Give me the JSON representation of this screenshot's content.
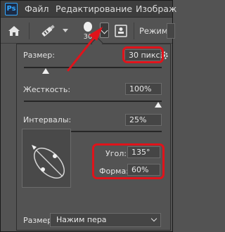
{
  "app": {
    "logo_text": "Ps",
    "menu": [
      {
        "label": "Файл"
      },
      {
        "label": "Редактирование"
      },
      {
        "label": "Изображ"
      }
    ]
  },
  "options_bar": {
    "home_icon": "home-icon",
    "brush_tool_icon": "brush-tool-icon",
    "brush_size": "30",
    "picker_icon": "chevron-down-icon",
    "stamp_icon": "stamp-icon",
    "mode_label": "Режим:"
  },
  "brush_panel": {
    "size": {
      "label": "Размер:",
      "value": "30 пикс.",
      "slider_fraction": 0.14
    },
    "hardness": {
      "label": "Жесткость:",
      "value": "100%",
      "slider_fraction": 1.0
    },
    "spacing": {
      "label": "Интервалы:",
      "value": "25%",
      "slider_fraction": 0.14
    },
    "angle": {
      "label": "Угол:",
      "value": "135°"
    },
    "roundness": {
      "label": "Форма:",
      "value": "60%"
    },
    "pen_control": {
      "label": "Размер:",
      "value": "Нажим пера"
    }
  },
  "colors": {
    "highlight": "#e0131b",
    "panel_bg": "#535353",
    "menubar_bg": "#3d3d3d"
  }
}
